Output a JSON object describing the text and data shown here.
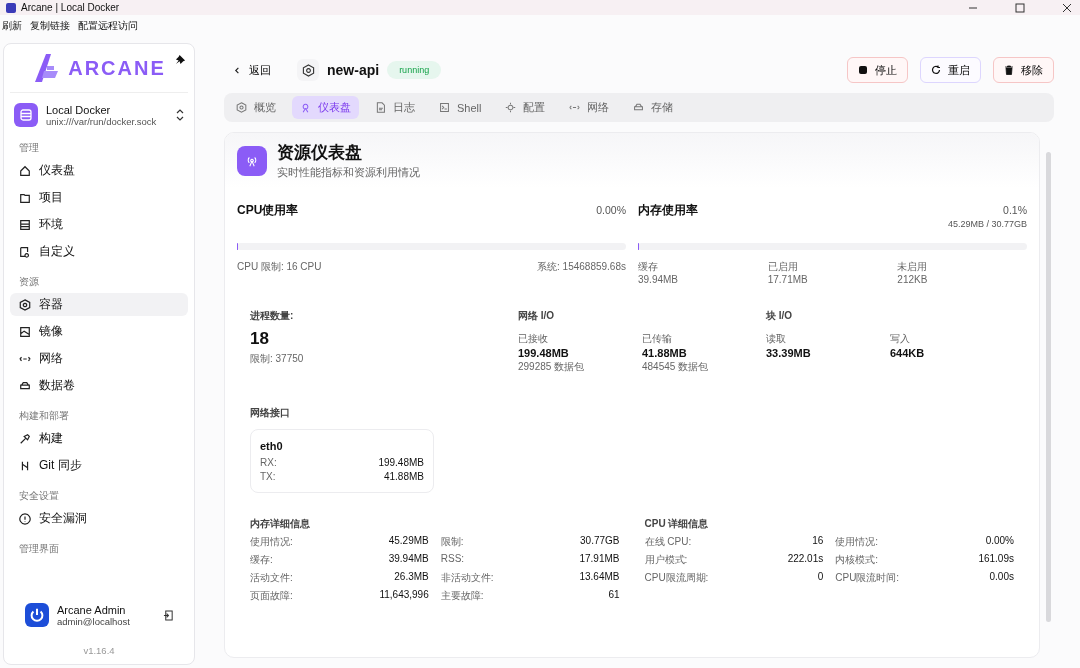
{
  "window": {
    "title": "Arcane | Local Docker",
    "menu": [
      "刷新",
      "复制链接",
      "配置远程访问"
    ]
  },
  "sidebar": {
    "logo": "ARCANE",
    "environment": {
      "name": "Local Docker",
      "socket": "unix:///var/run/docker.sock"
    },
    "sections": [
      {
        "heading": "管理",
        "items": [
          {
            "label": "仪表盘",
            "selected": false
          },
          {
            "label": "项目",
            "selected": false
          },
          {
            "label": "环境",
            "selected": false
          },
          {
            "label": "自定义",
            "selected": false
          }
        ]
      },
      {
        "heading": "资源",
        "items": [
          {
            "label": "容器",
            "selected": true
          },
          {
            "label": "镜像",
            "selected": false
          },
          {
            "label": "网络",
            "selected": false
          },
          {
            "label": "数据卷",
            "selected": false
          }
        ]
      },
      {
        "heading": "构建和部署",
        "items": [
          {
            "label": "构建",
            "selected": false
          },
          {
            "label": "Git 同步",
            "selected": false
          }
        ]
      },
      {
        "heading": "安全设置",
        "items": [
          {
            "label": "安全漏洞",
            "selected": false
          }
        ]
      },
      {
        "heading": "管理界面"
      }
    ],
    "user": {
      "name": "Arcane Admin",
      "email": "admin@localhost"
    },
    "version": "v1.16.4"
  },
  "header": {
    "back": "返回",
    "name": "new-api",
    "status": "running",
    "actions": [
      {
        "label": "停止",
        "kind": "stop"
      },
      {
        "label": "重启",
        "kind": "restart"
      },
      {
        "label": "移除",
        "kind": "remove"
      }
    ]
  },
  "tabs": [
    {
      "label": "概览",
      "selected": false
    },
    {
      "label": "仪表盘",
      "selected": true
    },
    {
      "label": "日志",
      "selected": false
    },
    {
      "label": "Shell",
      "selected": false
    },
    {
      "label": "配置",
      "selected": false
    },
    {
      "label": "网络",
      "selected": false
    },
    {
      "label": "存储",
      "selected": false
    }
  ],
  "dashboard": {
    "title": "资源仪表盘",
    "subtitle": "实时性能指标和资源利用情况",
    "cpu": {
      "title": "CPU使用率",
      "value": "0.00%",
      "level": 0.0,
      "limit": "CPU 限制: 16 CPU",
      "system": "系统: 15468859.68s"
    },
    "memory": {
      "title": "内存使用率",
      "value": "0.1%",
      "detail": "45.29MB / 30.77GB",
      "level": 0.001,
      "stats": [
        {
          "label": "缓存",
          "value": "39.94MB"
        },
        {
          "label": "已启用",
          "value": "17.71MB"
        },
        {
          "label": "未启用",
          "value": "212KB"
        }
      ]
    },
    "processes": {
      "label": "进程数量:",
      "value": "18",
      "limit": "限制: 37750"
    },
    "network_io": {
      "title": "网络 I/O",
      "items": [
        {
          "label": "已接收",
          "value": "199.48MB",
          "sub": "299285 数据包"
        },
        {
          "label": "已传输",
          "value": "41.88MB",
          "sub": "484545 数据包"
        }
      ]
    },
    "block_io": {
      "title": "块 I/O",
      "items": [
        {
          "label": "读取",
          "value": "33.39MB"
        },
        {
          "label": "写入",
          "value": "644KB"
        }
      ]
    },
    "interfaces": {
      "title": "网络接口",
      "items": [
        {
          "name": "eth0",
          "rows": [
            {
              "label": "RX:",
              "value": "199.48MB"
            },
            {
              "label": "TX:",
              "value": "41.88MB"
            }
          ]
        }
      ]
    },
    "memory_details": {
      "title": "内存详细信息",
      "rows": [
        {
          "label": "使用情况:",
          "value": "45.29MB"
        },
        {
          "label": "限制:",
          "value": "30.77GB"
        },
        {
          "label": "缓存:",
          "value": "39.94MB"
        },
        {
          "label": "RSS:",
          "value": "17.91MB"
        },
        {
          "label": "活动文件:",
          "value": "26.3MB"
        },
        {
          "label": "非活动文件:",
          "value": "13.64MB"
        },
        {
          "label": "页面故障:",
          "value": "11,643,996"
        },
        {
          "label": "主要故障:",
          "value": "61"
        }
      ]
    },
    "cpu_details": {
      "title": "CPU 详细信息",
      "rows": [
        {
          "label": "在线 CPU:",
          "value": "16"
        },
        {
          "label": "使用情况:",
          "value": "0.00%"
        },
        {
          "label": "用户模式:",
          "value": "222.01s"
        },
        {
          "label": "内核模式:",
          "value": "161.09s"
        },
        {
          "label": "CPU限流周期:",
          "value": "0"
        },
        {
          "label": "CPU限流时间:",
          "value": "0.00s"
        }
      ]
    }
  }
}
